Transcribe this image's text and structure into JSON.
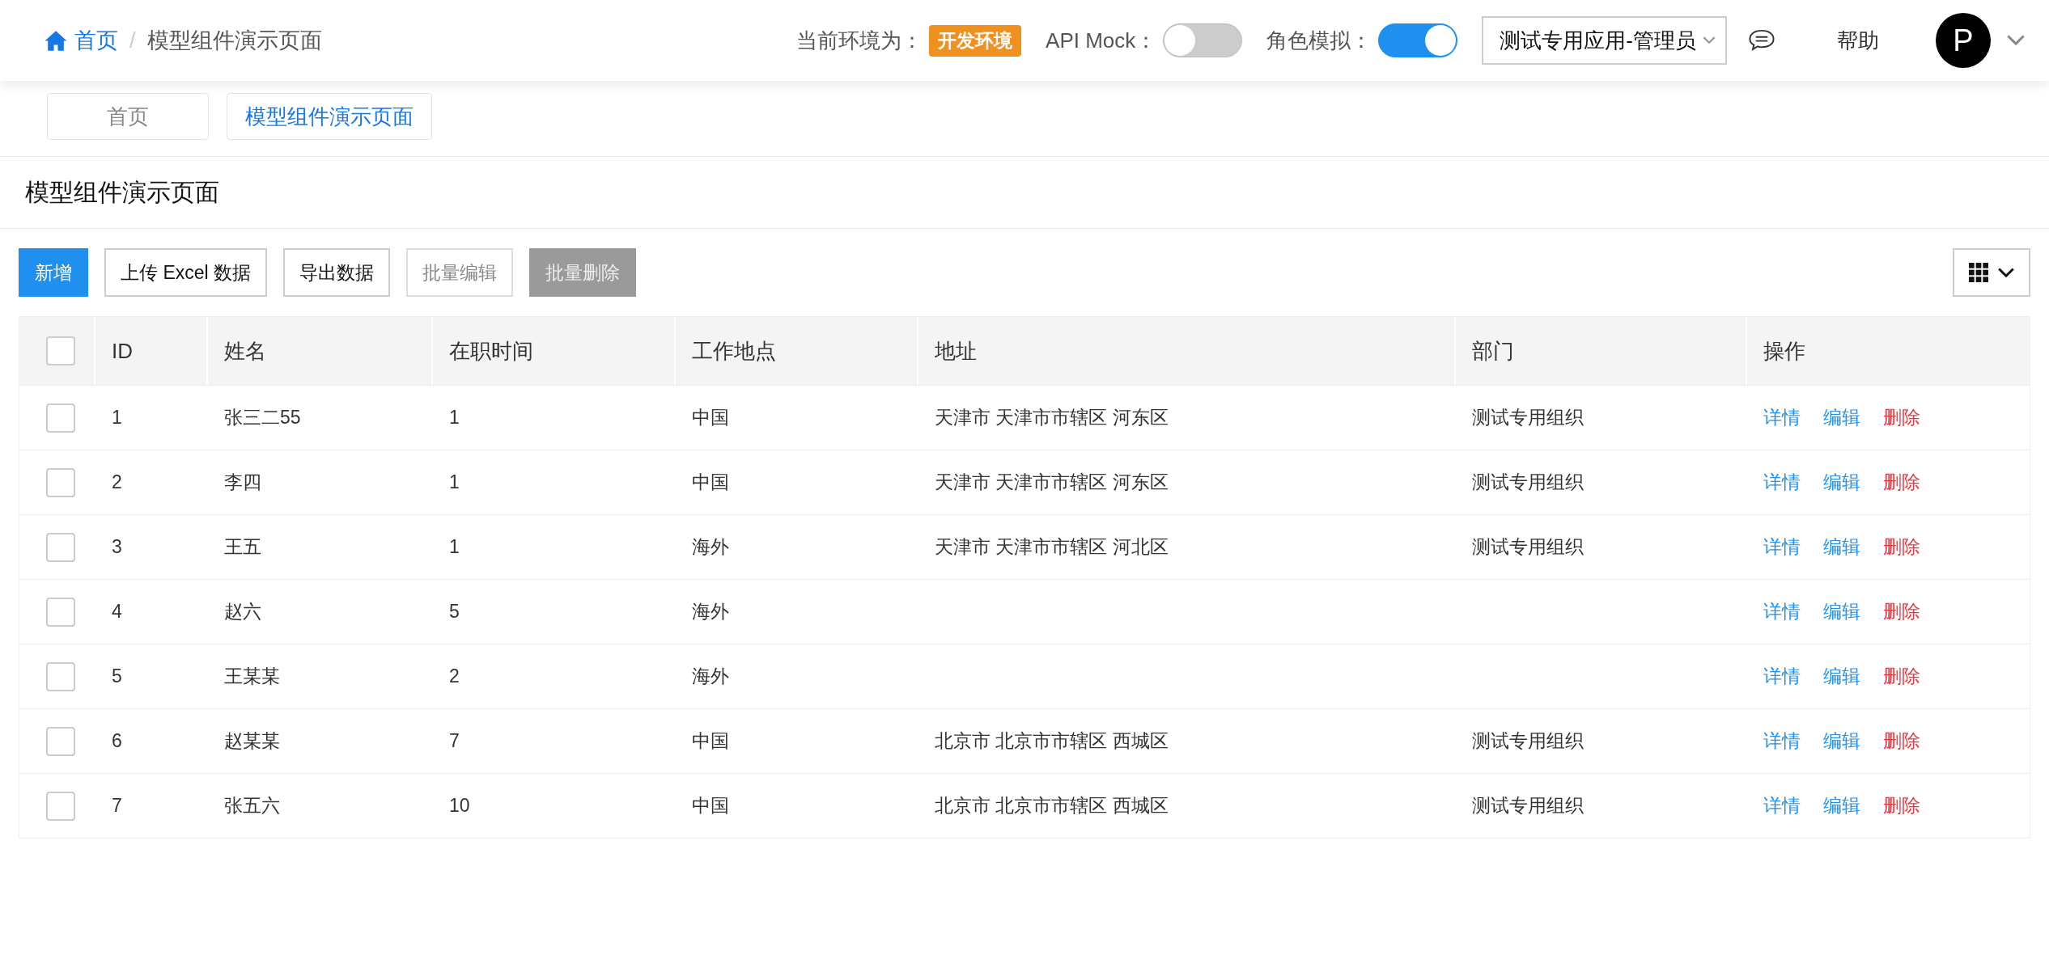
{
  "breadcrumb": [
    {
      "label": "首页",
      "kind": "home"
    },
    {
      "label": "/",
      "kind": "separator"
    },
    {
      "label": "模型组件演示页面",
      "kind": "current"
    }
  ],
  "header": {
    "env_label": "当前环境为：",
    "env_badge": "开发环境",
    "api_mock": {
      "label": "API Mock：",
      "on": false
    },
    "role_sim": {
      "label": "角色模拟：",
      "on": true
    },
    "app_select": {
      "value": "测试专用应用-管理员"
    },
    "help": "帮助",
    "avatar": "P"
  },
  "tabs": [
    {
      "label": "首页",
      "selected": false
    },
    {
      "label": "模型组件演示页面",
      "selected": true
    }
  ],
  "page_title": "模型组件演示页面",
  "toolbar": [
    {
      "label": "新增",
      "kind": "primary",
      "disabled": false
    },
    {
      "label": "上传 Excel 数据",
      "kind": "default",
      "disabled": false
    },
    {
      "label": "导出数据",
      "kind": "default",
      "disabled": false
    },
    {
      "label": "批量编辑",
      "kind": "default",
      "disabled": true
    },
    {
      "label": "批量删除",
      "kind": "danger",
      "disabled": true
    }
  ],
  "table": {
    "select_all": {
      "checked": false
    },
    "columns": [
      "ID",
      "姓名",
      "在职时间",
      "工作地点",
      "地址",
      "部门",
      "操作"
    ],
    "rows": [
      {
        "checked": false,
        "cells": [
          "1",
          "张三二55",
          "1",
          "中国",
          "天津市 天津市市辖区 河东区",
          "测试专用组织"
        ],
        "actions": [
          {
            "label": "详情",
            "kind": "link"
          },
          {
            "label": "编辑",
            "kind": "link"
          },
          {
            "label": "删除",
            "kind": "danger"
          }
        ]
      },
      {
        "checked": false,
        "cells": [
          "2",
          "李四",
          "1",
          "中国",
          "天津市 天津市市辖区 河东区",
          "测试专用组织"
        ],
        "actions": [
          {
            "label": "详情",
            "kind": "link"
          },
          {
            "label": "编辑",
            "kind": "link"
          },
          {
            "label": "删除",
            "kind": "danger"
          }
        ]
      },
      {
        "checked": false,
        "cells": [
          "3",
          "王五",
          "1",
          "海外",
          "天津市 天津市市辖区 河北区",
          "测试专用组织"
        ],
        "actions": [
          {
            "label": "详情",
            "kind": "link"
          },
          {
            "label": "编辑",
            "kind": "link"
          },
          {
            "label": "删除",
            "kind": "danger"
          }
        ]
      },
      {
        "checked": false,
        "cells": [
          "4",
          "赵六",
          "5",
          "海外",
          "",
          ""
        ],
        "actions": [
          {
            "label": "详情",
            "kind": "link"
          },
          {
            "label": "编辑",
            "kind": "link"
          },
          {
            "label": "删除",
            "kind": "danger"
          }
        ]
      },
      {
        "checked": false,
        "cells": [
          "5",
          "王某某",
          "2",
          "海外",
          "",
          ""
        ],
        "actions": [
          {
            "label": "详情",
            "kind": "link"
          },
          {
            "label": "编辑",
            "kind": "link"
          },
          {
            "label": "删除",
            "kind": "danger"
          }
        ]
      },
      {
        "checked": false,
        "cells": [
          "6",
          "赵某某",
          "7",
          "中国",
          "北京市 北京市市辖区 西城区",
          "测试专用组织"
        ],
        "actions": [
          {
            "label": "详情",
            "kind": "link"
          },
          {
            "label": "编辑",
            "kind": "link"
          },
          {
            "label": "删除",
            "kind": "danger"
          }
        ]
      },
      {
        "checked": false,
        "cells": [
          "7",
          "张五六",
          "10",
          "中国",
          "北京市 北京市市辖区 西城区",
          "测试专用组织"
        ],
        "actions": [
          {
            "label": "详情",
            "kind": "link"
          },
          {
            "label": "编辑",
            "kind": "link"
          },
          {
            "label": "删除",
            "kind": "danger"
          }
        ]
      }
    ]
  }
}
